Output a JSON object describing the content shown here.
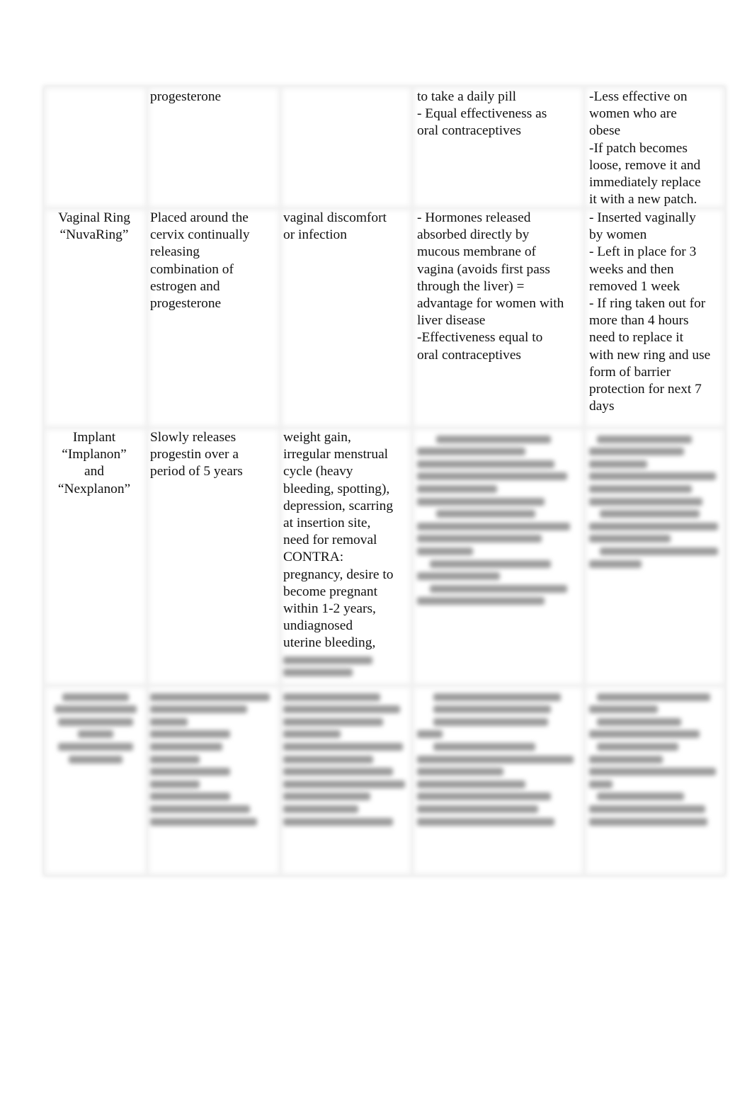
{
  "document": {
    "table": {
      "rows": [
        {
          "method": "",
          "mechanism": "progesterone",
          "side_effects": "",
          "advantages": "to take a daily pill\n- Equal effectiveness as\noral contraceptives",
          "notes": "-Less effective on\nwomen who are\nobese\n-If patch becomes\nloose, remove it and\nimmediately replace\nit with a new patch."
        },
        {
          "method": "Vaginal Ring\n“NuvaRing”",
          "mechanism": "Placed around the\ncervix continually\nreleasing\ncombination of\nestrogen and\nprogesterone",
          "side_effects": "vaginal discomfort\nor infection",
          "advantages": "- Hormones released\nabsorbed directly by\nmucous membrane of\nvagina (avoids first pass\nthrough the liver) =\nadvantage for women with\nliver disease\n-Effectiveness equal to\noral contraceptives",
          "notes": "- Inserted vaginally\nby women\n- Left in place for 3\nweeks and then\nremoved 1 week\n- If ring taken out for\nmore than 4 hours\nneed to replace it\nwith new ring and use\nform of barrier\nprotection for next 7\ndays"
        },
        {
          "method": "Implant\n“Implanon”\nand\n“Nexplanon”",
          "mechanism": "Slowly releases\nprogestin over a\nperiod of 5 years",
          "side_effects": "weight gain,\nirregular menstrual\ncycle (heavy\nbleeding, spotting),\ndepression, scarring\nat insertion site,\nneed for removal\nCONTRA:\npregnancy, desire to\nbecome pregnant\nwithin 1-2 years,\nundiagnosed\nuterine bleeding,",
          "advantages": "",
          "notes": ""
        },
        {
          "method": "",
          "mechanism": "",
          "side_effects": "",
          "advantages": "",
          "notes": ""
        }
      ],
      "blurred_note": "content obscured (blurred preview)"
    }
  }
}
